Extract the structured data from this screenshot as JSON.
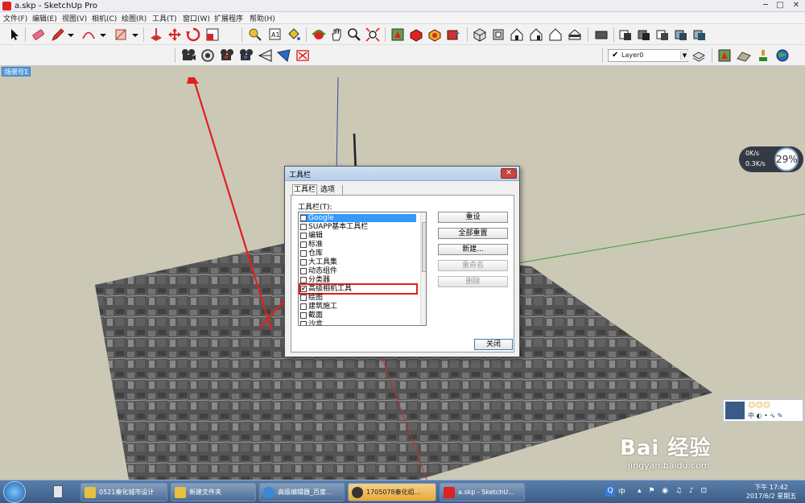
{
  "window": {
    "title": "a.skp - SketchUp Pro",
    "minimize": "─",
    "maximize": "□",
    "close": "✕"
  },
  "menu": [
    "文件(F)",
    "编辑(E)",
    "视图(V)",
    "相机(C)",
    "绘图(R)",
    "工具(T)",
    "窗口(W)",
    "扩展程序",
    "帮助(H)"
  ],
  "layer": {
    "check": "✔",
    "name": "Layer0",
    "arrow": "▼"
  },
  "scene_tab": "场景号1",
  "network": {
    "up": "0K/s",
    "down": "0.3K/s",
    "percent": "29%"
  },
  "dialog": {
    "title": "工具栏",
    "close": "✕",
    "tabs": [
      "工具栏",
      "选项"
    ],
    "list_label": "工具栏(T):",
    "items": [
      {
        "label": "Google",
        "checked": true,
        "selected": true
      },
      {
        "label": "SUAPP基本工具栏",
        "checked": false
      },
      {
        "label": "编辑",
        "checked": false
      },
      {
        "label": "标准",
        "checked": false
      },
      {
        "label": "仓库",
        "checked": false
      },
      {
        "label": "大工具集",
        "checked": false
      },
      {
        "label": "动态组件",
        "checked": false
      },
      {
        "label": "分类器",
        "checked": false
      },
      {
        "label": "高级相机工具",
        "checked": true,
        "highlight": true
      },
      {
        "label": "绘图",
        "checked": false
      },
      {
        "label": "建筑施工",
        "checked": false
      },
      {
        "label": "截面",
        "checked": false
      },
      {
        "label": "沙盒",
        "checked": false
      }
    ],
    "buttons": {
      "reset": "重设",
      "reset_all": "全部重置",
      "new": "新建...",
      "rename": "重命名",
      "delete": "删除",
      "close": "关闭"
    }
  },
  "taskbar": {
    "tasks": [
      {
        "label": "0521秦化城市设计"
      },
      {
        "label": "新建文件夹"
      },
      {
        "label": "高级编辑器_百度..."
      },
      {
        "label": "1705078秦化组..."
      },
      {
        "label": "a.skp - SketchU..."
      }
    ],
    "time": "下午 17:42",
    "date": "2017/6/2 星期五"
  },
  "ime": {
    "chars": "中 ◐ • ∿ ✎"
  },
  "watermark": {
    "logo": "Bai 经验",
    "url": "jingyan.baidu.com"
  },
  "colors": {
    "highlight_red": "#e02020",
    "selection_blue": "#3399ff",
    "accent_red": "#d22222"
  },
  "icons": {
    "toolbar1": [
      "select-arrow-icon",
      "eraser-icon",
      "pencil-icon",
      "dropdown-icon",
      "arc-icon",
      "dropdown-icon",
      "rectangle-icon",
      "dropdown-icon",
      "push-pull-icon",
      "move-icon",
      "rotate-icon",
      "scale-icon",
      "tape-measure-icon",
      "text-icon",
      "paint-bucket-icon",
      "orbit-icon",
      "pan-icon",
      "zoom-icon",
      "zoom-extents-icon",
      "warehouse-icon",
      "extension-icon",
      "3d-warehouse-icon",
      "share-icon",
      "iso-view-icon",
      "top-view-icon",
      "front-view-icon",
      "right-view-icon",
      "back-view-icon",
      "left-view-icon",
      "section-plane-icon",
      "style-xray-icon",
      "style-wireframe-icon",
      "style-hidden-icon",
      "style-shaded-icon",
      "style-textured-icon"
    ],
    "toolbar2": [
      "camera-create-icon",
      "camera-look-icon",
      "camera-edit-icon",
      "camera-reset-icon",
      "camera-frustum-icon",
      "camera-lines-icon",
      "camera-delete-icon"
    ]
  }
}
